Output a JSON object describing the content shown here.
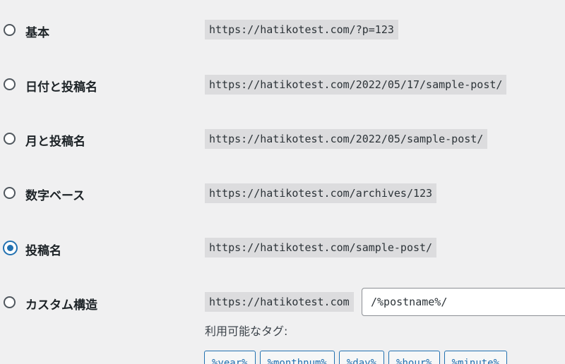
{
  "options": [
    {
      "label": "基本",
      "example": "https://hatikotest.com/?p=123",
      "checked": false
    },
    {
      "label": "日付と投稿名",
      "example": "https://hatikotest.com/2022/05/17/sample-post/",
      "checked": false
    },
    {
      "label": "月と投稿名",
      "example": "https://hatikotest.com/2022/05/sample-post/",
      "checked": false
    },
    {
      "label": "数字ベース",
      "example": "https://hatikotest.com/archives/123",
      "checked": false
    },
    {
      "label": "投稿名",
      "example": "https://hatikotest.com/sample-post/",
      "checked": true
    },
    {
      "label": "カスタム構造",
      "example": "https://hatikotest.com",
      "checked": false
    }
  ],
  "custom": {
    "value": "/%postname%/",
    "available_tags_label": "利用可能なタグ:",
    "tags": [
      "%year%",
      "%monthnum%",
      "%day%",
      "%hour%",
      "%minute%"
    ]
  },
  "colors": {
    "accent": "#2271b1",
    "code_bg": "#dcdcde",
    "page_bg": "#f0f0f1"
  }
}
